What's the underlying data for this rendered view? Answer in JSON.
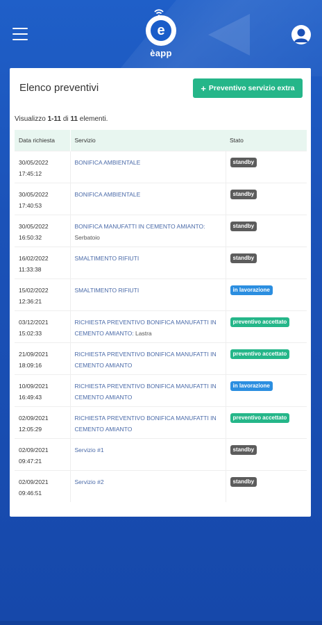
{
  "app": {
    "logo_text": "èapp",
    "logo_letter": "e"
  },
  "page": {
    "title": "Elenco preventivi",
    "add_button_label": "Preventivo servizio extra",
    "summary_prefix": "Visualizzo ",
    "summary_range": "1-11",
    "summary_mid": " di ",
    "summary_total": "11",
    "summary_suffix": " elementi."
  },
  "table": {
    "headers": [
      "Data richiesta",
      "Servizio",
      "Stato"
    ],
    "rows": [
      {
        "date": "30/05/2022",
        "time": "17:45:12",
        "service": "BONIFICA AMBIENTALE",
        "sub": "",
        "status": "standby"
      },
      {
        "date": "30/05/2022",
        "time": "17:40:53",
        "service": "BONIFICA AMBIENTALE",
        "sub": "",
        "status": "standby"
      },
      {
        "date": "30/05/2022",
        "time": "16:50:32",
        "service": "BONIFICA MANUFATTI IN CEMENTO AMIANTO:",
        "sub": " Serbatoio",
        "status": "standby"
      },
      {
        "date": "16/02/2022",
        "time": "11:33:38",
        "service": "SMALTIMENTO RIFIUTI",
        "sub": "",
        "status": "standby"
      },
      {
        "date": "15/02/2022",
        "time": "12:36:21",
        "service": "SMALTIMENTO RIFIUTI",
        "sub": "",
        "status": "in lavorazione"
      },
      {
        "date": "03/12/2021",
        "time": "15:02:33",
        "service": "RICHIESTA PREVENTIVO BONIFICA MANUFATTI IN CEMENTO AMIANTO:",
        "sub": " Lastra",
        "status": "preventivo accettato"
      },
      {
        "date": "21/09/2021",
        "time": "18:09:16",
        "service": "RICHIESTA PREVENTIVO BONIFICA MANUFATTI IN CEMENTO AMIANTO",
        "sub": "",
        "status": "preventivo accettato"
      },
      {
        "date": "10/09/2021",
        "time": "16:49:43",
        "service": "RICHIESTA PREVENTIVO BONIFICA MANUFATTI IN CEMENTO AMIANTO",
        "sub": "",
        "status": "in lavorazione"
      },
      {
        "date": "02/09/2021",
        "time": "12:05:29",
        "service": "RICHIESTA PREVENTIVO BONIFICA MANUFATTI IN CEMENTO AMIANTO",
        "sub": "",
        "status": "preventivo accettato"
      },
      {
        "date": "02/09/2021",
        "time": "09:47:21",
        "service": "Servizio #1",
        "sub": "",
        "status": "standby"
      },
      {
        "date": "02/09/2021",
        "time": "09:46:51",
        "service": "Servizio #2",
        "sub": "",
        "status": "standby"
      }
    ]
  },
  "status_colors": {
    "standby": "#5c5c5c",
    "in lavorazione": "#2b8ee0",
    "preventivo accettato": "#25b689"
  },
  "icons": {
    "menu": "hamburger-icon",
    "user": "user-icon",
    "add": "plus-icon"
  }
}
